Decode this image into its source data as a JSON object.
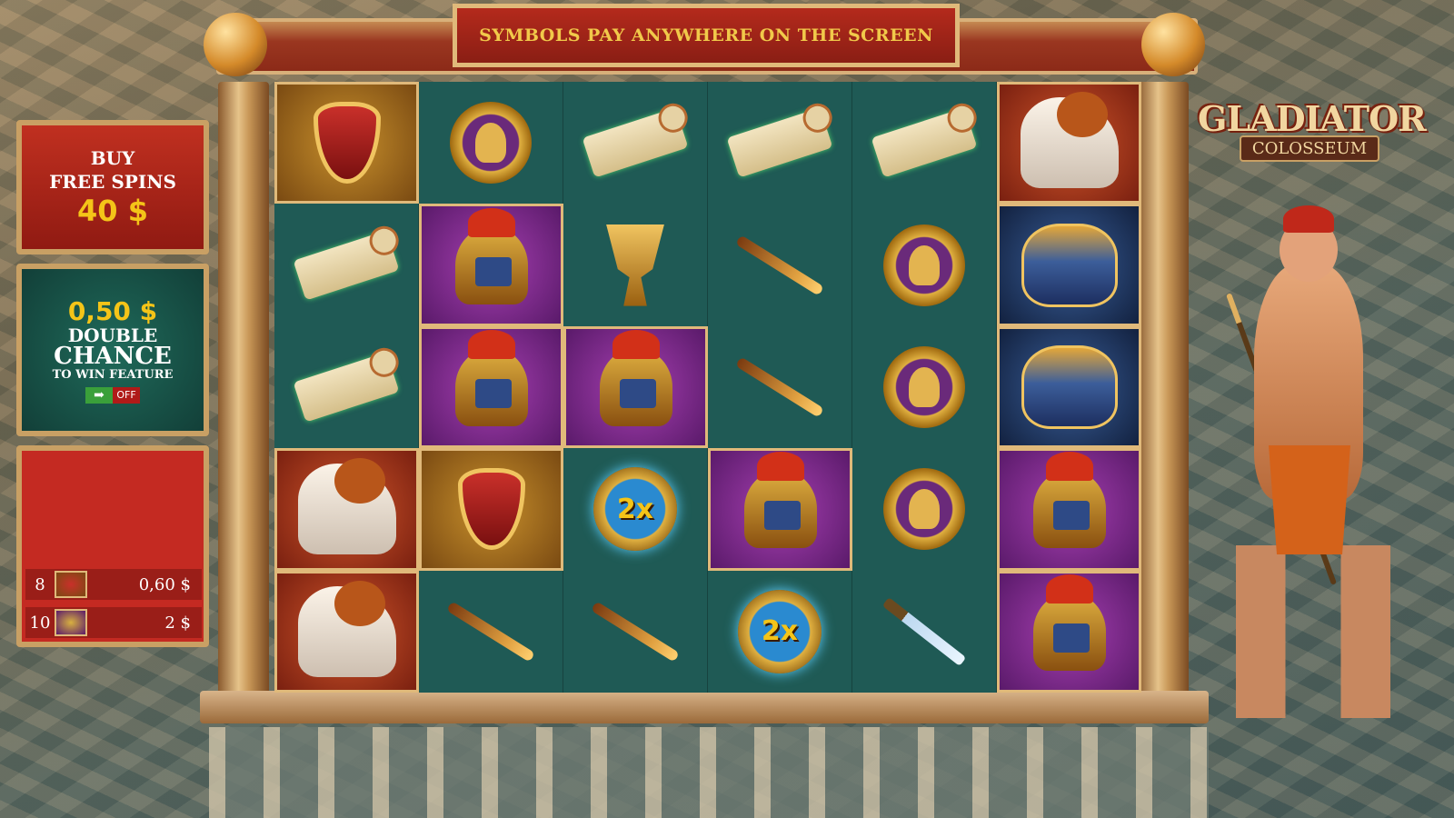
{
  "banner": {
    "text": "SYMBOLS PAY ANYWHERE ON THE SCREEN"
  },
  "buy_free_spins": {
    "line1": "BUY",
    "line2": "FREE SPINS",
    "price": "40 $"
  },
  "double_chance": {
    "amount": "0,50 $",
    "line1": "DOUBLE",
    "line2": "CHANCE",
    "line3": "TO WIN FEATURE",
    "toggle_state": "OFF",
    "toggle_arrow": "➡"
  },
  "paytable": [
    {
      "count": "8",
      "icon": "shield-icon",
      "value": "0,60 $"
    },
    {
      "count": "10",
      "icon": "helmet-icon",
      "value": "2 $"
    }
  ],
  "logo": {
    "title": "GLADIATOR",
    "subtitle": "COLOSSEUM"
  },
  "multiplier_label": "2x",
  "grid": [
    [
      "shield",
      "coin",
      "scroll",
      "scroll",
      "scroll",
      "horse"
    ],
    [
      "scroll",
      "helmet",
      "cup",
      "spear",
      "coin",
      "armor"
    ],
    [
      "scroll",
      "helmet",
      "helmet",
      "spear",
      "coin",
      "armor"
    ],
    [
      "horse",
      "shield",
      "mult",
      "helmet",
      "coin",
      "helmet"
    ],
    [
      "horse",
      "spear",
      "spear",
      "mult",
      "sword",
      "helmet"
    ]
  ],
  "tiles": [
    [
      "gold",
      "",
      "",
      "",
      "",
      "red"
    ],
    [
      "",
      "purple",
      "",
      "",
      "",
      "blue"
    ],
    [
      "",
      "purple",
      "purple",
      "",
      "",
      "blue"
    ],
    [
      "red",
      "gold",
      "",
      "purple",
      "",
      "purple"
    ],
    [
      "red",
      "",
      "",
      "",
      "",
      "purple"
    ]
  ],
  "colors": {
    "accent_gold": "#f4c418",
    "banner_red": "#b42a1c",
    "reel_bg": "#1f5a55"
  }
}
